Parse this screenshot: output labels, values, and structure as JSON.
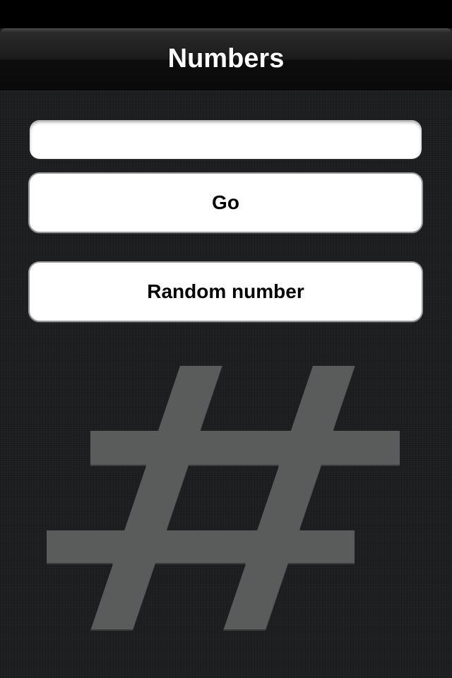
{
  "nav_bar": {
    "title": "Numbers"
  },
  "number_input": {
    "value": "",
    "placeholder": ""
  },
  "go_button": {
    "label": "Go"
  },
  "random_button": {
    "label": "Random number"
  },
  "decoration": {
    "icon": "hash-icon",
    "color": "#5a5b5c"
  },
  "colors": {
    "background": "#1d1e20",
    "nav_bar": "#1b1b1b",
    "button_background": "#ffffff",
    "text_dark": "#000000",
    "text_light": "#ffffff"
  }
}
